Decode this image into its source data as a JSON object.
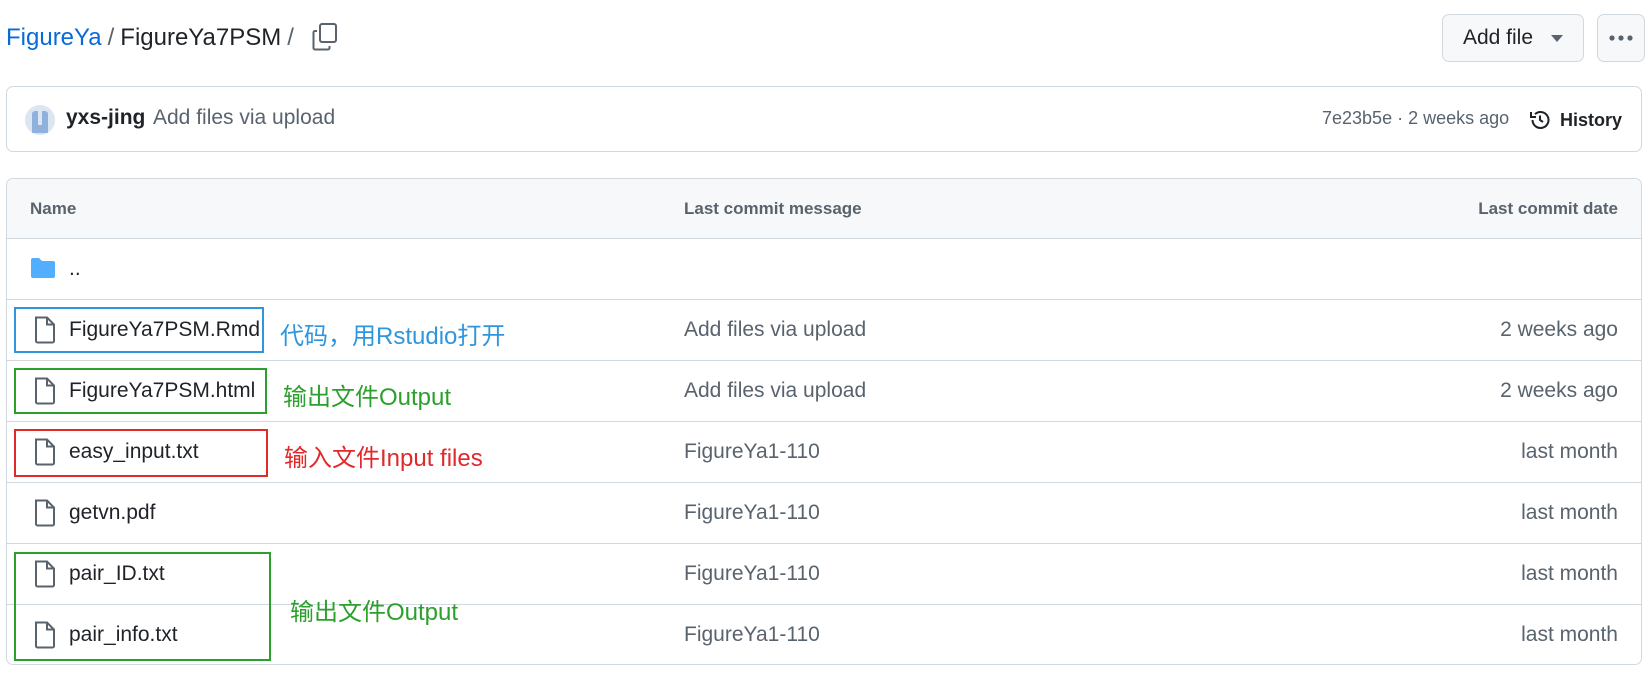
{
  "breadcrumb": {
    "repo": "FigureYa",
    "separator": "/",
    "folder": "FigureYa7PSM",
    "trailing_separator": "/"
  },
  "toolbar": {
    "add_file_label": "Add file"
  },
  "latest_commit": {
    "author": "yxs-jing",
    "message": "Add files via upload",
    "meta": "7e23b5e · 2 weeks ago",
    "history_label": "History"
  },
  "table": {
    "headers": {
      "name": "Name",
      "message": "Last commit message",
      "date": "Last commit date"
    },
    "parent_dir": "..",
    "rows": [
      {
        "name": "FigureYa7PSM.Rmd",
        "message": "Add files via upload",
        "date": "2 weeks ago"
      },
      {
        "name": "FigureYa7PSM.html",
        "message": "Add files via upload",
        "date": "2 weeks ago"
      },
      {
        "name": "easy_input.txt",
        "message": "FigureYa1-110",
        "date": "last month"
      },
      {
        "name": "getvn.pdf",
        "message": "FigureYa1-110",
        "date": "last month"
      },
      {
        "name": "pair_ID.txt",
        "message": "FigureYa1-110",
        "date": "last month"
      },
      {
        "name": "pair_info.txt",
        "message": "FigureYa1-110",
        "date": "last month"
      }
    ]
  },
  "annotations": [
    {
      "text": "代码，用Rstudio打开",
      "color": "#2f96dd"
    },
    {
      "text": "输出文件Output",
      "color": "#2ca02c"
    },
    {
      "text": "输入文件Input files",
      "color": "#e0292b"
    },
    {
      "text": "输出文件Output",
      "color": "#2ca02c"
    }
  ],
  "colors": {
    "link": "#0969da",
    "muted": "#59636e",
    "border": "#d1d9e0",
    "header_bg": "#f6f8fa",
    "folder": "#54aeff"
  },
  "icons": [
    "copy-icon",
    "caret-down-icon",
    "kebab-horizontal-icon",
    "history-icon",
    "folder-icon",
    "file-icon"
  ]
}
